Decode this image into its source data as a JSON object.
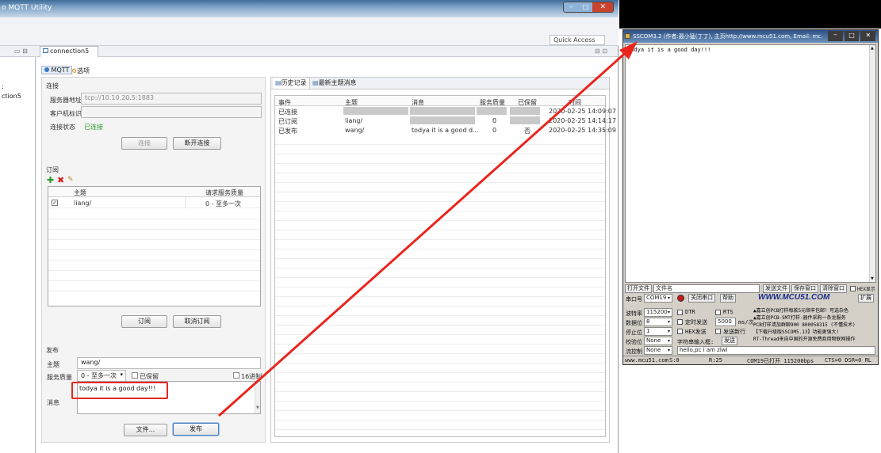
{
  "app_title": "o MQTT Utility",
  "quick_access": "Quick Access",
  "left_sidebar": {
    "item1": ":",
    "item2": "ction5"
  },
  "editor_tab": {
    "label": "connection5",
    "close": "✕"
  },
  "inner_tabs": {
    "mqtt": "MQTT",
    "options": "选项"
  },
  "connection": {
    "section_title": "连接",
    "server_label": "服务器地址",
    "server_value": "tcp://10.10.20.5:1883",
    "client_label": "客户机标识",
    "client_value": "",
    "status_label": "连接状态",
    "status_value": "已连接",
    "connect_btn": "连接",
    "disconnect_btn": "断开连接"
  },
  "subscribe": {
    "section_title": "订阅",
    "col_topic": "主题",
    "col_qos": "请求服务质量",
    "rows": [
      {
        "topic": "liang/",
        "qos": "0 - 至多一次"
      }
    ],
    "subscribe_btn": "订阅",
    "unsubscribe_btn": "取消订阅"
  },
  "publish": {
    "section_title": "发布",
    "topic_label": "主题",
    "topic_value": "wang/",
    "qos_label": "服务质量",
    "qos_value": "0 - 至多一次",
    "retained_label": "已保留",
    "hex_label": "16进制",
    "message_label": "消息",
    "message_value": "todya it is a good day!!!",
    "file_btn": "文件...",
    "publish_btn": "发布"
  },
  "history": {
    "tab_history": "历史记录",
    "tab_latest": "最新主题消息",
    "columns": [
      "事件",
      "主题",
      "消息",
      "服务质量",
      "已保留",
      "时间"
    ],
    "rows": [
      {
        "event": "已连接",
        "topic": "",
        "message": "",
        "qos": "",
        "retained": "",
        "time": "2020-02-25 14:09:07"
      },
      {
        "event": "已订阅",
        "topic": "liang/",
        "message": "",
        "qos": "0",
        "retained": "",
        "time": "2020-02-25 14:14:17"
      },
      {
        "event": "已发布",
        "topic": "wang/",
        "message": "todya it is a good d...",
        "qos": "0",
        "retained": "否",
        "time": "2020-02-25 14:35:09"
      }
    ]
  },
  "sscom": {
    "title": "SSCOM3.2 (作者:聂小猛(丁丁), 主页http://www.mcu51.com, Email: mc...",
    "received_text": "todya it is a good day!!!",
    "open_file": "打开文件",
    "file_name": "文件名",
    "send_file": "发送文件",
    "save_window": "保存窗口",
    "clear_window": "清除窗口",
    "hex_display": "HEX显示",
    "port_label": "串口号",
    "port_value": "COM19",
    "close_port": "关闭串口",
    "help": "帮助",
    "website": "WWW.MCU51.COM",
    "expand": "扩展",
    "baud_label": "波特率",
    "baud_value": "115200",
    "databits_label": "数据位",
    "databits_value": "8",
    "stopbits_label": "停止位",
    "stopbits_value": "1",
    "parity_label": "校验位",
    "parity_value": "None",
    "flow_label": "流控制",
    "flow_value": "None",
    "dtr": "DTR",
    "rts": "RTS",
    "timed_send": "定时发送",
    "interval": "5000",
    "interval_unit": "ms/次",
    "hex_send": "HEX发送",
    "send_newline": "发送新行",
    "input_label": "字符串输入框:",
    "send_btn": "发送",
    "input_value": "hello,pc i am zlwl",
    "ad1": "▲嘉立创PCB打样每款5元顺丰包邮！可选杂色",
    "ad2": "▲嘉立创PCB-SMT打样-器件采购一条龙服务",
    "ad3": "PCB打样请加群聊900 800058315 (不懂技术)",
    "ad4": "【下载升级版SSCOM5.13】功能更强大!",
    "ad5": "RT-Thread来自中国的开源免费商用物联网操作",
    "status_site": "www.mcu51.com",
    "status_s": "S:0",
    "status_r": "R:25",
    "status_port": "COM19已打开  115200bps",
    "status_lines": "CTS=0 DSR=0 RL"
  },
  "colors": {
    "arrow": "#e8261e",
    "highlight": "#e8261e",
    "status_green": "#2a9a2a"
  }
}
